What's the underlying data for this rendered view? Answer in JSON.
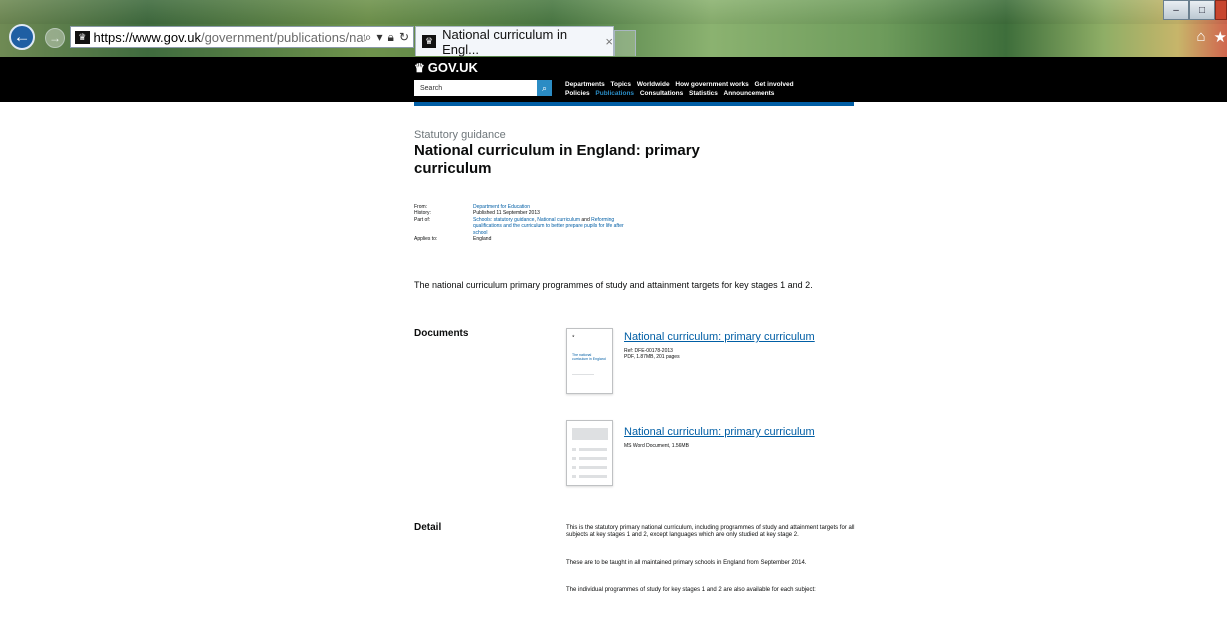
{
  "browser": {
    "url_host": "https://www.gov.uk",
    "url_path": "/government/publications/nati",
    "tab_title": "National curriculum in Engl...",
    "tab_close": "×",
    "back_glyph": "←",
    "forward_glyph": "→",
    "favicon": "crown-icon",
    "address_controls": [
      "search-icon",
      "dropdown-icon",
      "lock-icon",
      "refresh-icon"
    ],
    "tools": [
      "home-icon",
      "favorites-star-icon"
    ],
    "window_controls": [
      "minimize",
      "maximize",
      "close"
    ]
  },
  "gov_header": {
    "logo_text": "GOV.UK",
    "search_placeholder": "Search",
    "nav_row1": [
      "Departments",
      "Topics",
      "Worldwide",
      "How government works",
      "Get involved"
    ],
    "nav_row2": [
      "Policies",
      "Publications",
      "Consultations",
      "Statistics",
      "Announcements"
    ],
    "active_nav": "Publications",
    "colors": {
      "header_bg": "#000000",
      "accent": "#005ea5",
      "active": "#2b8cc4"
    }
  },
  "page": {
    "doc_type": "Statutory guidance",
    "title": "National curriculum in England: primary curriculum",
    "meta": {
      "from_label": "From:",
      "from_value": "Department for Education",
      "history_label": "History:",
      "history_value": "Published 11 September 2013",
      "part_of_label": "Part of:",
      "part_of_line1_a": "Schools: statutory guidance",
      "part_of_line1_sep": ", ",
      "part_of_line1_b": "National curriculum",
      "part_of_line1_and": " and ",
      "part_of_line1_c": "Reforming",
      "part_of_line2": "qualifications and the curriculum to better prepare pupils for life after",
      "part_of_line3": "school",
      "applies_label": "Applies to:",
      "applies_value": "England"
    },
    "summary": "The national curriculum primary programmes of study and attainment targets for key stages 1 and 2.",
    "documents_heading": "Documents",
    "documents": [
      {
        "title": "National curriculum: primary curriculum",
        "ref": "Ref: DFE-00178-2013",
        "info": "PDF, 1.87MB, 201 pages",
        "thumb_text": "The national curriculum in England"
      },
      {
        "title": "National curriculum: primary curriculum",
        "info": "MS Word Document, 1.56MB"
      }
    ],
    "detail_heading": "Detail",
    "detail_paragraphs": [
      "This is the statutory primary national curriculum, including programmes of study and attainment targets for all subjects at key stages 1 and 2, except languages which are only studied at key stage 2.",
      "These are to be taught in all maintained primary schools in England from September 2014.",
      "The individual programmes of study for key stages 1 and 2 are also available for each subject:"
    ]
  }
}
